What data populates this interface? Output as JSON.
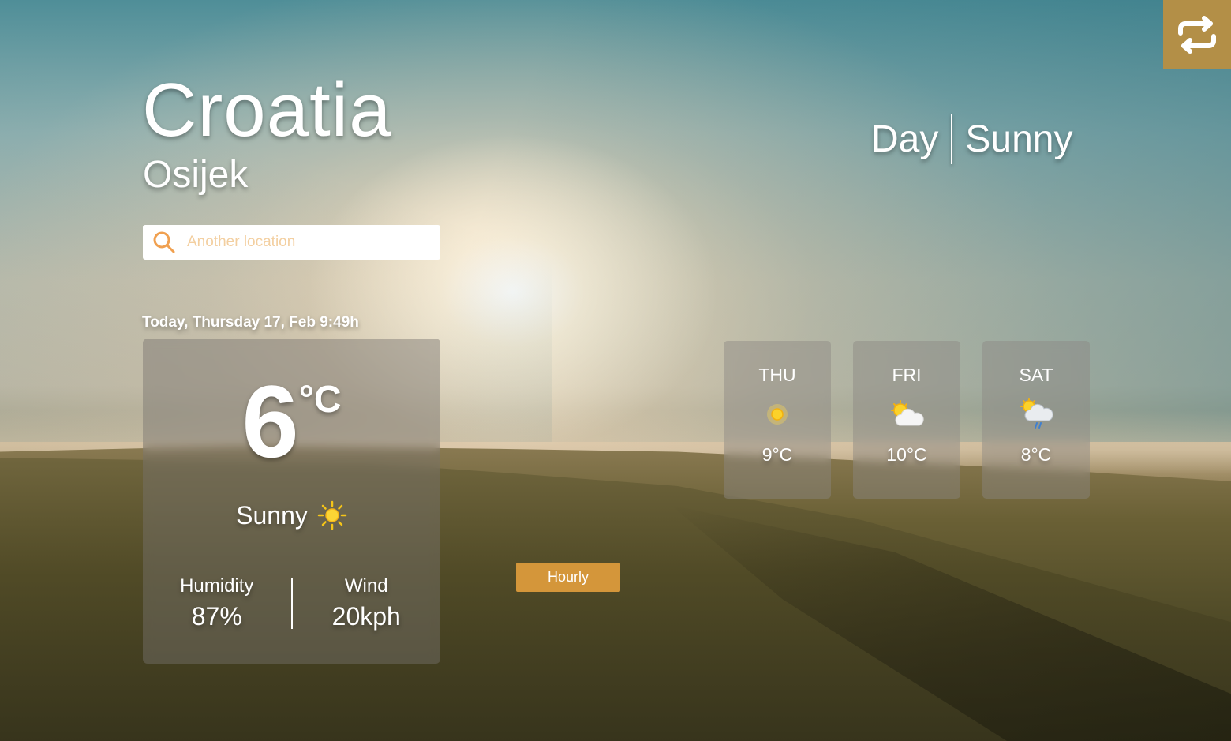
{
  "location": {
    "country": "Croatia",
    "city": "Osijek"
  },
  "period": {
    "time_of_day": "Day",
    "condition": "Sunny"
  },
  "search": {
    "placeholder": "Another location",
    "icon": "search-icon"
  },
  "swap_button": {
    "icon": "swap-arrows-icon"
  },
  "today": {
    "date_text": "Today, Thursday 17, Feb 9:49h",
    "temperature": "6",
    "unit": "°C",
    "condition": "Sunny",
    "condition_icon": "sun-icon",
    "humidity_label": "Humidity",
    "humidity_value": "87%",
    "wind_label": "Wind",
    "wind_value": "20kph"
  },
  "hourly_button": {
    "label": "Hourly"
  },
  "forecast": [
    {
      "day": "THU",
      "temp": "9°C",
      "icon": "sun-icon"
    },
    {
      "day": "FRI",
      "temp": "10°C",
      "icon": "sun-cloud-icon"
    },
    {
      "day": "SAT",
      "temp": "8°C",
      "icon": "sun-cloud-rain-icon"
    }
  ],
  "colors": {
    "accent": "#b38f47",
    "button": "#d4963a",
    "placeholder": "#f3cfa0"
  }
}
